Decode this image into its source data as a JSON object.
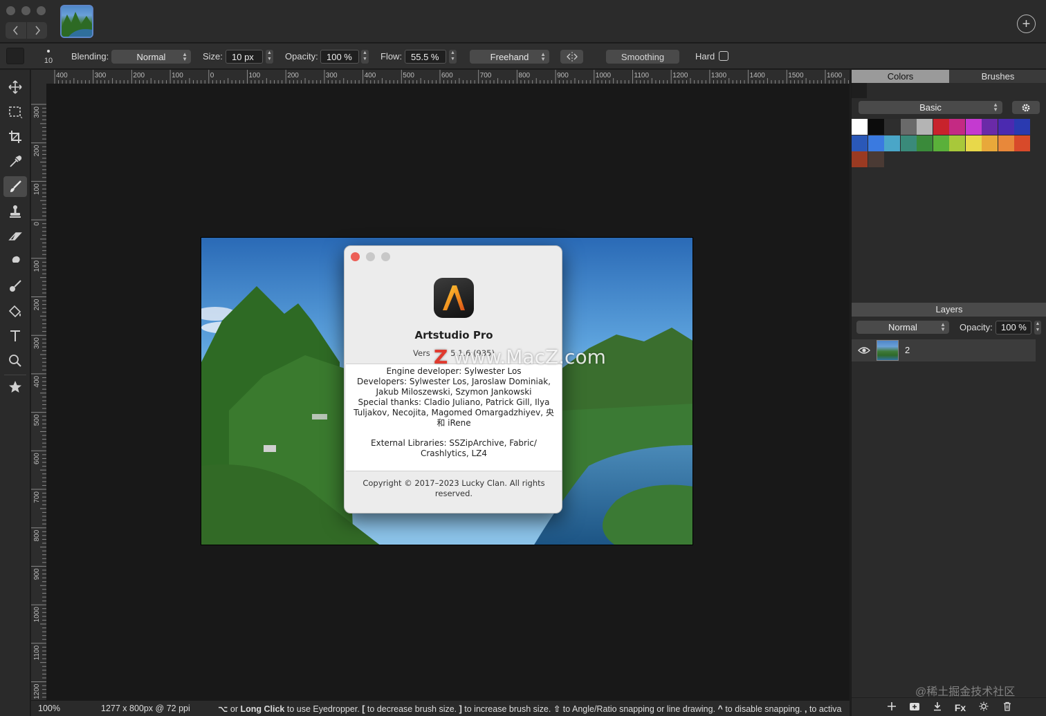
{
  "window": {
    "add_icon": "plus-circle-icon"
  },
  "options": {
    "brush_size_preview": "10",
    "blending_label": "Blending:",
    "blending_value": "Normal",
    "size_label": "Size:",
    "size_value": "10 px",
    "opacity_label": "Opacity:",
    "opacity_value": "100 %",
    "flow_label": "Flow:",
    "flow_value": "55.5 %",
    "mode_value": "Freehand",
    "smoothing_label": "Smoothing",
    "hard_label": "Hard",
    "hard_checked": false
  },
  "tools": [
    {
      "name": "move-tool",
      "icon": "move-icon"
    },
    {
      "name": "marquee-tool",
      "icon": "marquee-icon"
    },
    {
      "name": "crop-tool",
      "icon": "crop-icon"
    },
    {
      "name": "eyedropper-tool",
      "icon": "eyedropper-icon"
    },
    {
      "name": "brush-tool",
      "icon": "brush-icon",
      "active": true
    },
    {
      "name": "stamp-tool",
      "icon": "stamp-icon"
    },
    {
      "name": "eraser-tool",
      "icon": "eraser-icon"
    },
    {
      "name": "smudge-tool",
      "icon": "smudge-icon"
    },
    {
      "name": "dodge-tool",
      "icon": "dodge-icon"
    },
    {
      "name": "fill-tool",
      "icon": "bucket-icon"
    },
    {
      "name": "text-tool",
      "icon": "text-icon"
    },
    {
      "name": "zoom-tool",
      "icon": "zoom-icon"
    },
    {
      "name": "favorites-tool",
      "icon": "star-icon"
    }
  ],
  "ruler": {
    "h_labels": [
      "400",
      "300",
      "200",
      "100",
      "0",
      "100",
      "200",
      "300",
      "400",
      "500",
      "600",
      "700",
      "800",
      "900",
      "1000",
      "1100",
      "1200",
      "1300",
      "1400",
      "1500",
      "1600"
    ],
    "v_labels": [
      "300",
      "200",
      "100",
      "0",
      "100",
      "200",
      "300",
      "400",
      "500",
      "600",
      "700",
      "800",
      "900",
      "1000",
      "1100",
      "1200"
    ]
  },
  "status": {
    "zoom": "100%",
    "dimensions": "1277 x 800px @ 72 ppi",
    "hint": {
      "k1": "⌥",
      "t1": " or ",
      "b1": "Long Click",
      "t2": " to use Eyedropper.  ",
      "k2": "[",
      "t3": " to decrease brush size.  ",
      "k3": "]",
      "t4": " to increase brush size.  ",
      "k4": "⇧",
      "t5": " to Angle/Ratio snapping or line drawing.  ",
      "k5": "^",
      "t6": " to disable snapping.  ",
      "k6": ",",
      "t7": " to activa"
    }
  },
  "right_panel": {
    "tabs": [
      "Colors",
      "Brushes"
    ],
    "active_tab": "Colors",
    "palette_select": "Basic",
    "gear_icon": "gear-icon",
    "swatches": [
      "#ffffff",
      "#0c0c0c",
      "#2e2e2e",
      "#6a6a6a",
      "#b4b4b4",
      "#c8232c",
      "#c42a83",
      "#c43ad0",
      "#6a2aa8",
      "#4b2ab0",
      "#2a3ab0",
      "#2a58b8",
      "#3a7ae0",
      "#4aa6c8",
      "#3a8a7a",
      "#3a8a3a",
      "#5ab03a",
      "#a8c83a",
      "#e8d84a",
      "#e8a83a",
      "#e8883a",
      "#d84a2a",
      "#9a3a22",
      "#4a3a34"
    ],
    "layers_header": "Layers",
    "layer_blend": "Normal",
    "layer_opacity_label": "Opacity:",
    "layer_opacity_value": "100 %",
    "layers": [
      {
        "name": "2",
        "visible": true
      }
    ],
    "layer_tools": [
      "add-layer-icon",
      "add-group-icon",
      "merge-down-icon",
      "fx-icon",
      "adjustments-icon",
      "trash-icon"
    ],
    "fx_label": "Fx",
    "watermark": "@稀土掘金技术社区"
  },
  "about": {
    "app_name": "Artstudio Pro",
    "version_prefix": "Vers",
    "version_suffix": "5.1.6 (935)",
    "engine": "Engine developer: Sylwester Los",
    "developers": "Developers: Sylwester Los, Jaroslaw Dominiak, Jakub Miloszewski, Szymon Jankowski",
    "thanks": "Special thanks: Cladio Juliano, Patrick Gill, Ilya Tuljakov, Necojita, Magomed Omargadzhiyev, 央和 iRene",
    "libraries": "External Libraries: SSZipArchive, Fabric/ Crashlytics, LZ4",
    "copyright": "Copyright © 2017–2023 Lucky Clan. All rights reserved."
  },
  "overlay": {
    "watermark_letter": "Z",
    "watermark_text": "www.MacZ.com"
  }
}
